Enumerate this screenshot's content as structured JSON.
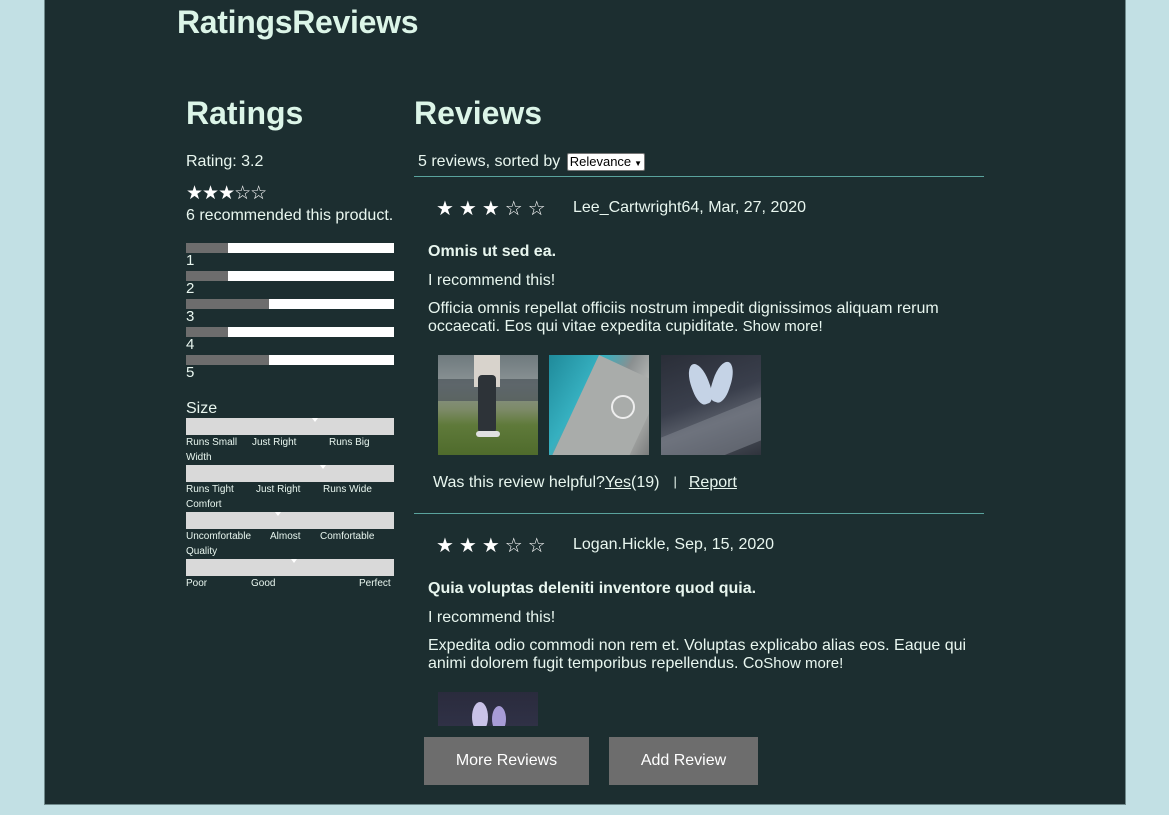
{
  "app": {
    "title": "RatingsReviews"
  },
  "ratings": {
    "heading": "Ratings",
    "rating_text": "Rating: 3.2",
    "stars": "★★★☆☆",
    "recommended_text": "6 recommended this product.",
    "breakdown": [
      {
        "label": "1",
        "fraction": 0.2
      },
      {
        "label": "2",
        "fraction": 0.2
      },
      {
        "label": "3",
        "fraction": 0.4
      },
      {
        "label": "4",
        "fraction": 0.2
      },
      {
        "label": "5",
        "fraction": 0.4
      }
    ],
    "characteristics": [
      {
        "name": "Size",
        "value_fraction": 0.62,
        "labels": [
          "Runs Small",
          "Just Right",
          "Runs Big"
        ]
      },
      {
        "name": "Width",
        "value_fraction": 0.66,
        "labels": [
          "Runs Tight",
          "Just Right",
          "Runs Wide"
        ]
      },
      {
        "name": "Comfort",
        "value_fraction": 0.44,
        "labels": [
          "Uncomfortable",
          "Almost",
          "Comfortable"
        ]
      },
      {
        "name": "Quality",
        "value_fraction": 0.52,
        "labels": [
          "Poor",
          "Good",
          "Perfect"
        ]
      }
    ]
  },
  "reviews": {
    "heading": "Reviews",
    "sort_prefix": "5 reviews, sorted by",
    "sort_selected": "Relevance",
    "items": [
      {
        "stars": "★★★☆☆",
        "meta": "Lee_Cartwright64, Mar, 27, 2020",
        "summary": "Omnis ut sed ea.",
        "recommend": "I recommend this!",
        "body": "Officia omnis repellat officiis nostrum impedit dignissimos aliquam rerum occaecati. Eos qui vitae expedita cupiditate.",
        "show_more": " Show more!",
        "helpful_prefix": "Was this review helpful?",
        "yes": "Yes",
        "yes_count": "(19)",
        "separator": "|",
        "report": "Report"
      },
      {
        "stars": "★★★☆☆",
        "meta": "Logan.Hickle, Sep, 15, 2020",
        "summary": "Quia voluptas deleniti inventore quod quia.",
        "recommend": "I recommend this!",
        "body": "Expedita odio commodi non rem et. Voluptas explicabo alias eos. Eaque qui animi dolorem fugit temporibus repellendus. Co",
        "show_more": "Show more!"
      }
    ]
  },
  "buttons": {
    "more_reviews": "More Reviews",
    "add_review": "Add Review"
  },
  "colors": {
    "background": "#c2e0e4",
    "panel": "#1c2e30",
    "divider": "#5aa39d",
    "button": "#6d6d6d"
  }
}
